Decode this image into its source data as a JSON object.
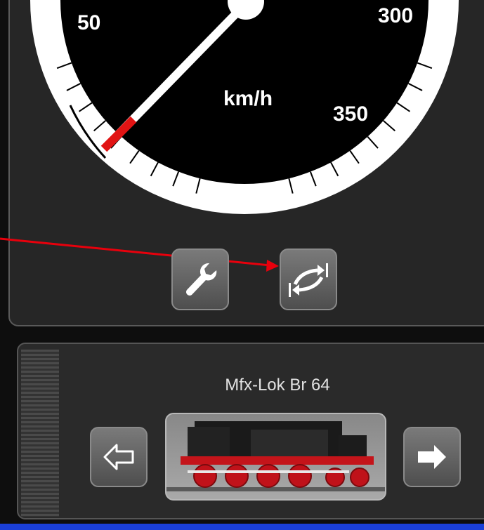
{
  "speedometer": {
    "unit": "km/h",
    "tick_labels": [
      "50",
      "300",
      "350"
    ]
  },
  "buttons": {
    "settings_icon": "wrench-icon",
    "direction_icon": "direction-change-icon"
  },
  "locomotive": {
    "name": "Mfx-Lok Br 64",
    "prev_icon": "arrow-left-outline-icon",
    "next_icon": "arrow-right-filled-icon"
  },
  "colors": {
    "needle_tip": "#e11414",
    "annotation_arrow": "#e8000c",
    "bottom_bar": "#1a3fd8"
  }
}
